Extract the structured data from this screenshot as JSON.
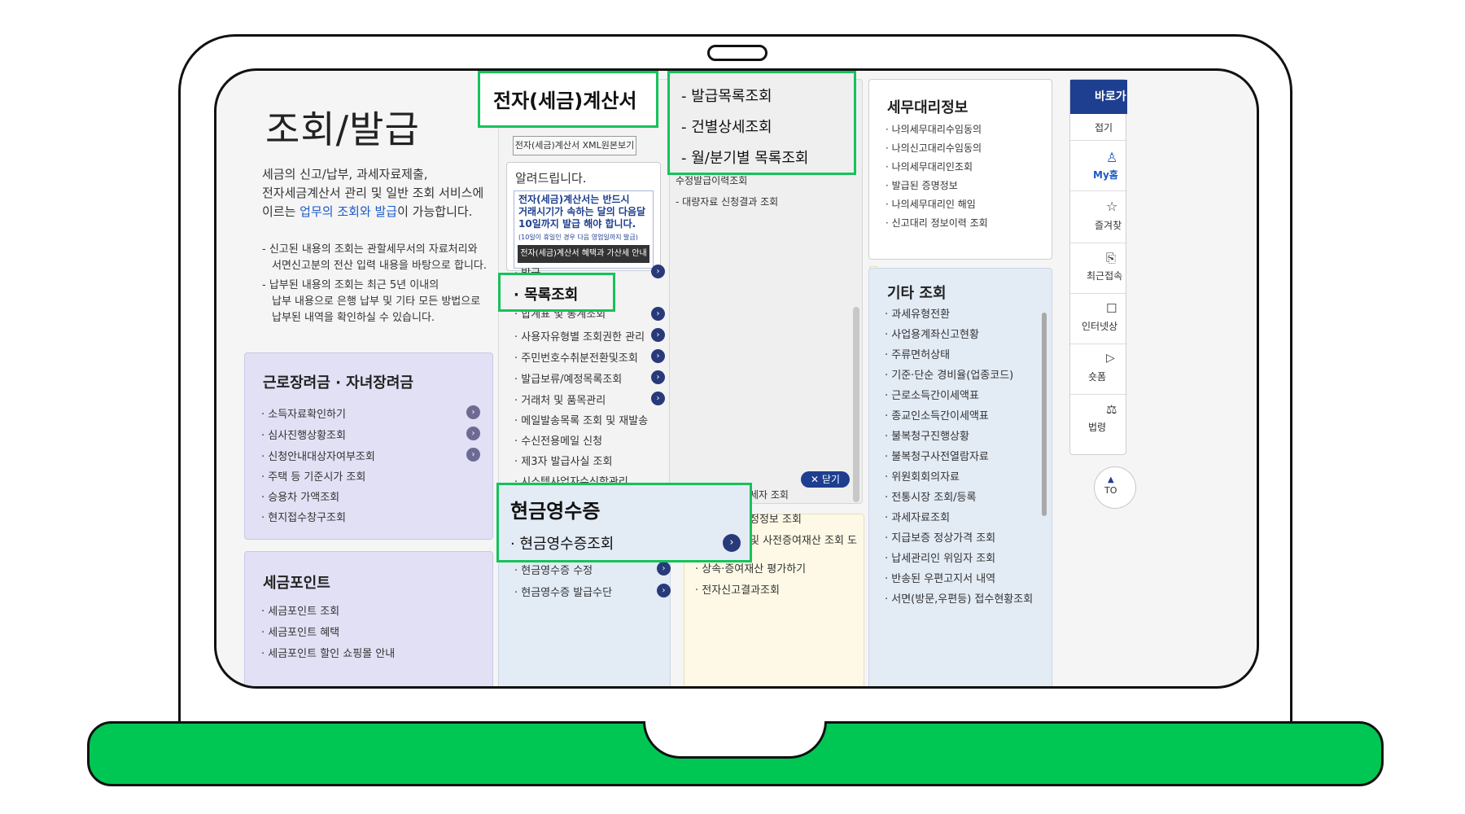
{
  "intro": {
    "title": "조회/발급",
    "desc_line1": "세금의 신고/납부, 과세자료제출,",
    "desc_line2": "전자세금계산서 관리 및 일반 조회 서비스에",
    "desc_line3_a": "이르는 ",
    "desc_line3_link": "업무의 조회와 발급",
    "desc_line3_b": "이 가능합니다.",
    "note1_line1": "- 신고된 내용의 조회는 관할세무서의 자료처리와",
    "note1_line2": "서면신고분의 전산 입력 내용을 바탕으로 합니다.",
    "note2_line1": "- 납부된 내용의 조회는 최근 5년 이내의",
    "note2_line2": "납부 내용으로 은행 납부 및 기타 모든 방법으로",
    "note2_line3": "납부된 내역을 확인하실 수 있습니다."
  },
  "earned_income": {
    "title": "근로장려금 · 자녀장려금",
    "items": [
      "소득자료확인하기",
      "심사진행상황조회",
      "신청안내대상자여부조회",
      "주택 등 기준시가 조회",
      "승용차 가액조회",
      "현지접수창구조회"
    ]
  },
  "tax_point": {
    "title": "세금포인트",
    "items": [
      "세금포인트 조회",
      "세금포인트 혜택",
      "세금포인트 할인 쇼핑몰 안내"
    ]
  },
  "etax_invoice": {
    "xml_button": "전자(세금)계산서 XML원본보기",
    "notice_title": "알려드립니다.",
    "notice_line1": "전자(세금)계산서는 반드시",
    "notice_line2": "거래시기가 속하는 달의 다음달",
    "notice_line3": "10일까지 발급 해야 합니다.",
    "notice_small": "(10일이 휴일인 경우 다음 영업일까지 발급)",
    "notice_button": "전자(세금)계산서 혜택과 가산세 안내",
    "item_issue": "발급",
    "item_stats": "합계표 및 통계조회",
    "items": [
      "사용자유형별 조회권한 관리",
      "주민번호수취분전환및조회",
      "발급보류/예정목록조회",
      "거래처 및 품목관리",
      "메일발송목록 조회 및 재발송",
      "수신전용메일 신청",
      "제3자 발급사실 조회",
      "시스템사업자수신함관리"
    ]
  },
  "submenu": {
    "items": [
      "수정발급이력조회",
      "대량자료 신청결과 조회"
    ],
    "close_label": "닫기"
  },
  "callouts": {
    "etax_title": "전자(세금)계산서",
    "list_items": [
      "- 발급목록조회",
      "- 건별상세조회",
      "- 월/분기별 목록조회"
    ],
    "list_query": "목록조회",
    "cash_title": "현금영수증",
    "cash_query": "현금영수증조회"
  },
  "cash_receipt": {
    "items": [
      "현금영수증 수정",
      "현금영수증 발급수단"
    ]
  },
  "other_middle": {
    "items": [
      "세자 조회",
      "정정보 조회",
      "및 사전증여재산 조회 도",
      "상속·증여재산 평가하기",
      "전자신고결과조회"
    ]
  },
  "tax_agent": {
    "title": "세무대리정보",
    "items": [
      "나의세무대리수임동의",
      "나의신고대리수임동의",
      "나의세무대리인조회",
      "발급된 증명정보",
      "나의세무대리인 해임",
      "신고대리 정보이력 조회"
    ]
  },
  "other_query": {
    "title": "기타 조회",
    "items": [
      "과세유형전환",
      "사업용계좌신고현황",
      "주류면허상태",
      "기준·단순 경비율(업종코드)",
      "근로소득간이세액표",
      "종교인소득간이세액표",
      "불복청구진행상황",
      "불복청구사전열람자료",
      "위원회회의자료",
      "전통시장 조회/등록",
      "과세자료조회",
      "지급보증 정상가격 조회",
      "납세관리인 위임자 조회",
      "반송된 우편고지서 내역",
      "서면(방문,우편등) 접수현황조회"
    ]
  },
  "quick_menu": {
    "title": "바로가",
    "collapse": "접기",
    "items": [
      "My홈",
      "즐겨찾",
      "최근접속",
      "인터넷상",
      "숏폼",
      "법령"
    ],
    "top": "TO"
  },
  "colors": {
    "accent_green": "#16c25a",
    "navy": "#1e3f8f",
    "lavender": "#e2e0f4",
    "light_blue": "#e3ebf5"
  }
}
